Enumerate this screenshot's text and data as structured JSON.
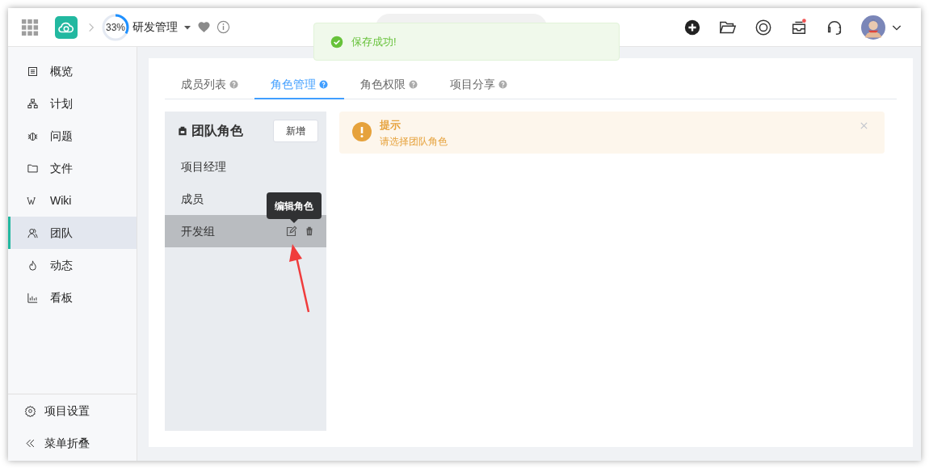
{
  "header": {
    "progress": {
      "label": "33%",
      "level": 0.33
    },
    "project": "研发管理"
  },
  "toast": {
    "message": "保存成功!"
  },
  "sidebar": {
    "items": [
      {
        "label": "概览",
        "selected": false
      },
      {
        "label": "计划",
        "selected": false
      },
      {
        "label": "问题",
        "selected": false
      },
      {
        "label": "文件",
        "selected": false
      },
      {
        "label": "Wiki",
        "selected": false
      },
      {
        "label": "团队",
        "selected": true
      },
      {
        "label": "动态",
        "selected": false
      },
      {
        "label": "看板",
        "selected": false
      }
    ],
    "footer": [
      {
        "label": "项目设置"
      },
      {
        "label": "菜单折叠"
      }
    ]
  },
  "tabs": [
    {
      "label": "成员列表",
      "selected": false
    },
    {
      "label": "角色管理",
      "selected": true
    },
    {
      "label": "角色权限",
      "selected": false
    },
    {
      "label": "项目分享",
      "selected": false
    }
  ],
  "roles": {
    "title": "团队角色",
    "add_button": "新增",
    "items": [
      {
        "label": "项目经理",
        "selected": false
      },
      {
        "label": "成员",
        "selected": false
      },
      {
        "label": "开发组",
        "selected": true
      }
    ],
    "tooltip": "编辑角色"
  },
  "alert": {
    "title": "提示",
    "message": "请选择团队角色"
  }
}
